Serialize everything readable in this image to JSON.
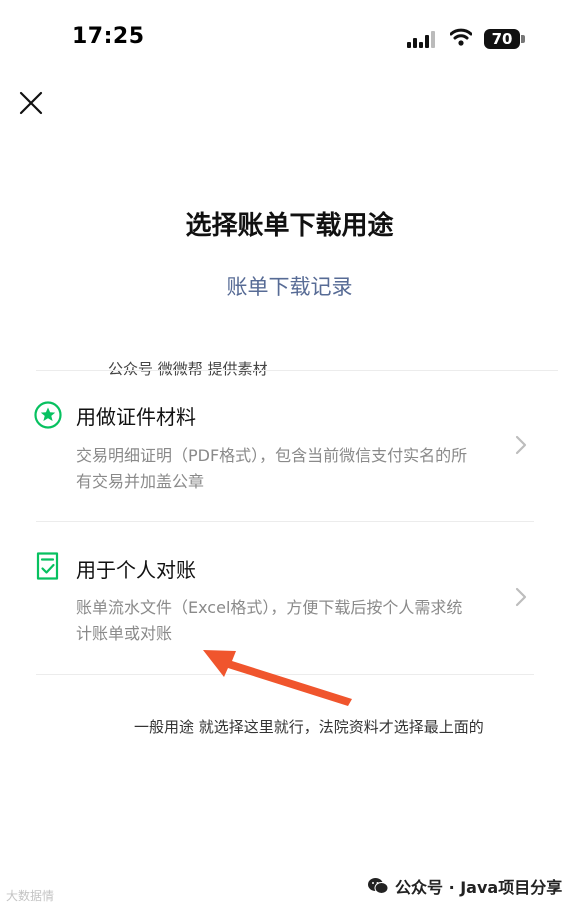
{
  "status_bar": {
    "time": "17:25",
    "battery": "70"
  },
  "header": {
    "title": "选择账单下载用途",
    "history_link": "账单下载记录"
  },
  "watermark_top": "公众号 微微帮 提供素材",
  "options": [
    {
      "title": "用做证件材料",
      "description": "交易明细证明（PDF格式），包含当前微信支付实名的所有交易并加盖公章",
      "icon": "star-badge-icon"
    },
    {
      "title": "用于个人对账",
      "description": "账单流水文件（Excel格式），方便下载后按个人需求统计账单或对账",
      "icon": "checklist-document-icon"
    }
  ],
  "annotation": "一般用途 就选择这里就行，法院资料才选择最上面的",
  "footer": {
    "brand": "公众号 · Java项目分享",
    "watermark": "大数据情"
  },
  "colors": {
    "accent_green": "#07c160",
    "link_blue": "#576b95",
    "arrow_red": "#f0552d"
  }
}
